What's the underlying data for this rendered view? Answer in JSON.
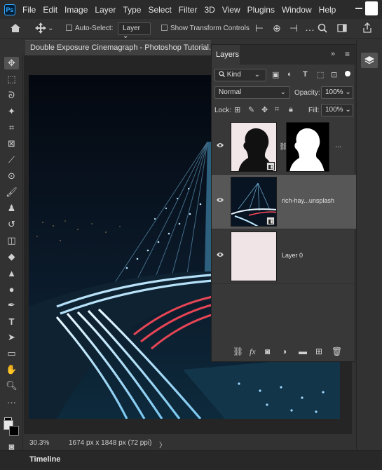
{
  "menubar": {
    "logo": "Ps",
    "items": [
      "File",
      "Edit",
      "Image",
      "Layer",
      "Type",
      "Select",
      "Filter",
      "3D",
      "View",
      "Plugins",
      "Window",
      "Help"
    ]
  },
  "options": {
    "auto_select": "Auto-Select:",
    "layer_target": "Layer",
    "show_transform": "Show Transform Controls"
  },
  "document": {
    "tab_title": "Double Exposure Cinemagraph - Photoshop Tutorial.psd",
    "close": "×"
  },
  "status": {
    "zoom": "30.3%",
    "dimensions": "1674 px x 1848 px (72 ppi)",
    "arrow": "〉"
  },
  "timeline": {
    "label": "Timeline"
  },
  "layers_panel": {
    "tab": "Layers",
    "filter_kind": "Kind",
    "blend_mode": "Normal",
    "opacity_label": "Opacity:",
    "opacity_value": "100%",
    "lock_label": "Lock:",
    "fill_label": "Fill:",
    "fill_value": "100%",
    "layers": [
      {
        "name": "",
        "has_mask": true,
        "selected": false
      },
      {
        "name": "rich-hay...unsplash",
        "has_mask": false,
        "selected": true
      },
      {
        "name": "Layer 0",
        "has_mask": false,
        "selected": false
      }
    ],
    "more": "..."
  },
  "colors": {
    "app_bg": "#323232",
    "menubar_bg": "#2b2b2b",
    "panel_bg": "#383838",
    "selected_layer": "#575757",
    "photo_dark": "#070d16",
    "light_trails_red": "#ff4a5a",
    "light_trails_blue": "#aee3ff"
  },
  "icons": [
    "home-icon",
    "move-icon",
    "layers-icon",
    "search-icon",
    "eye-icon",
    "link-icon",
    "fx-icon",
    "trash-icon"
  ]
}
